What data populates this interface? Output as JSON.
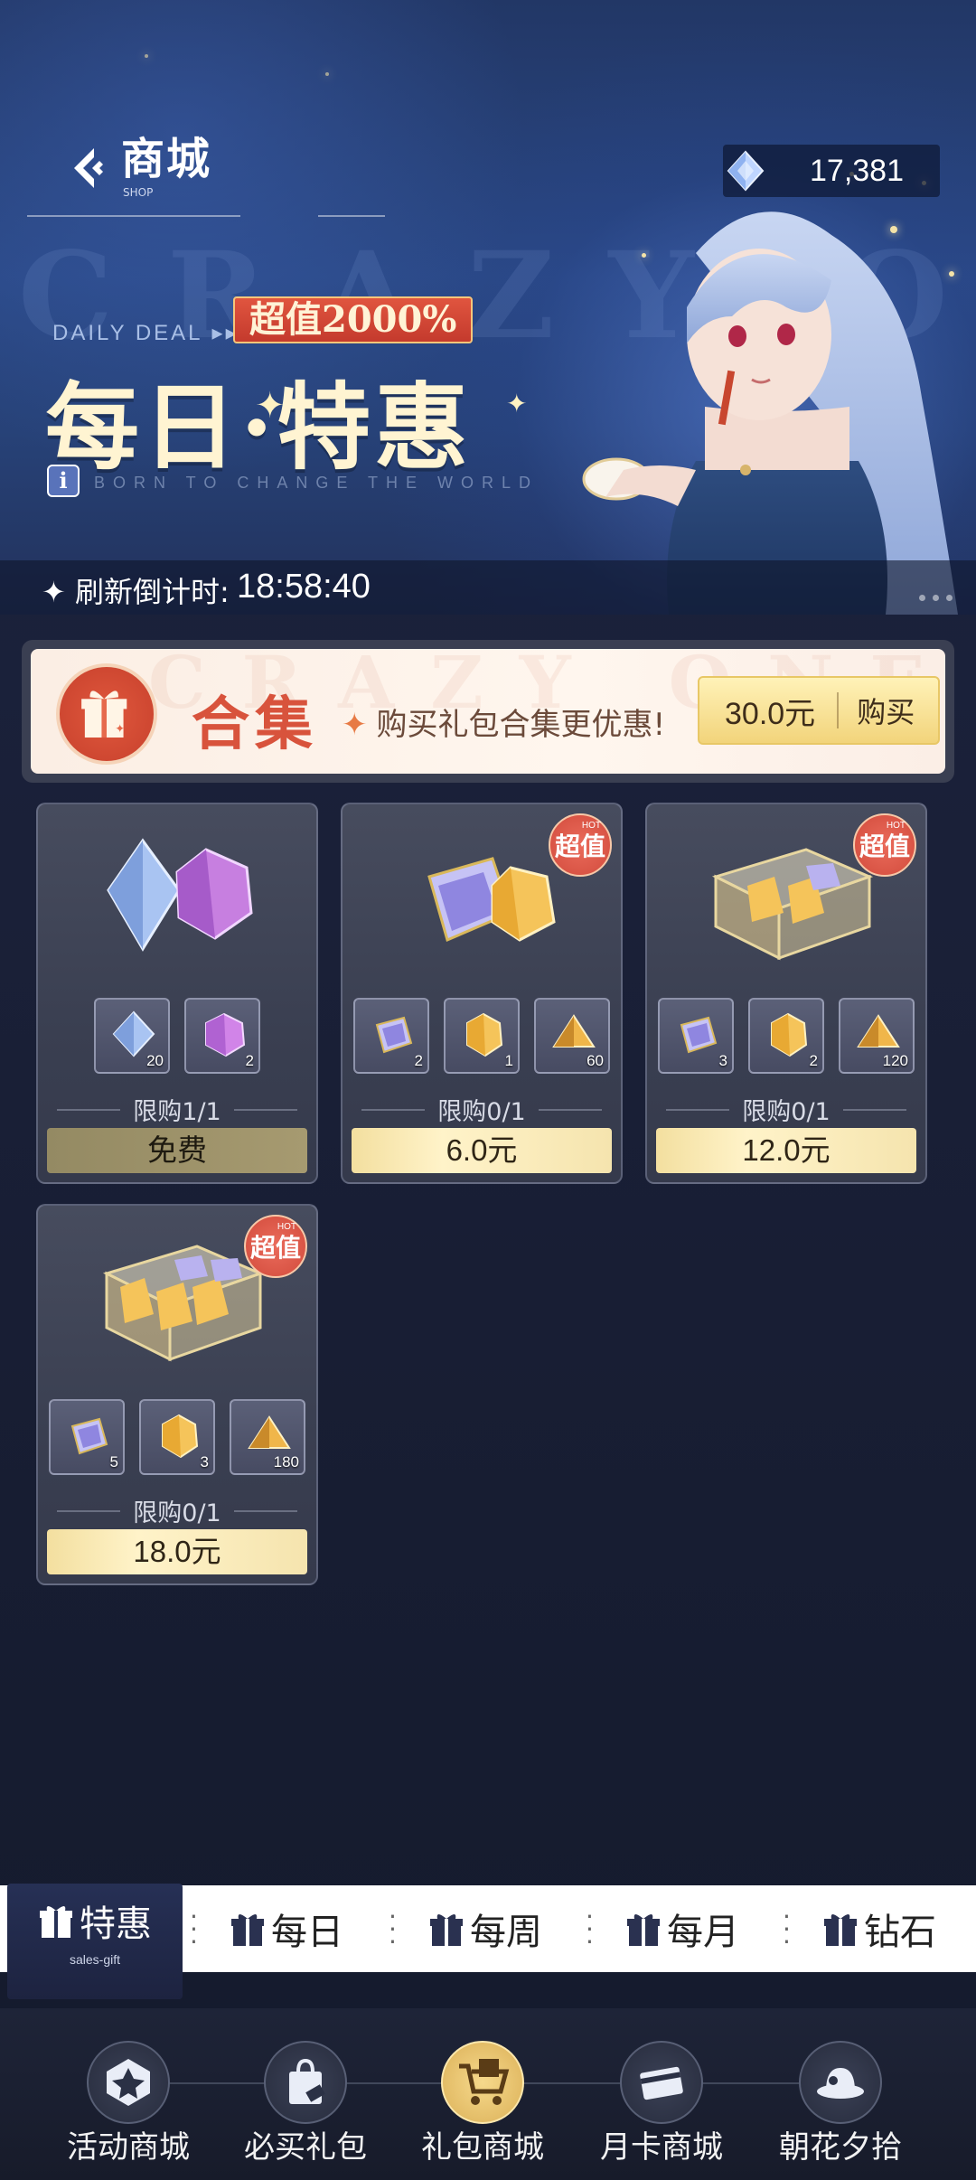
{
  "header": {
    "title": "商城",
    "subtitle": "SHOP",
    "currency_value": "17,381"
  },
  "banner": {
    "bg_text": "CRAZY ONES",
    "daily_label": "DAILY DEAL",
    "value_badge": "超值2000%",
    "deal_title": "每日·特惠",
    "info_letter": "i",
    "tagline": "BORN TO CHANGE THE WORLD",
    "countdown_label": "刷新倒计时:",
    "countdown_time": "18:58:40"
  },
  "bundle": {
    "bg_text": "CRAZY ONES",
    "title": "合集",
    "description": "购买礼包合集更优惠!",
    "price": "30.0元",
    "buy_label": "购买"
  },
  "cards": [
    {
      "hot": false,
      "rewards": [
        {
          "icon": "blue-diamond-icon",
          "qty": "20"
        },
        {
          "icon": "pink-crystal-icon",
          "qty": "2"
        }
      ],
      "limit": "限购1/1",
      "price": "免费"
    },
    {
      "hot": true,
      "rewards": [
        {
          "icon": "caged-crystal-icon",
          "qty": "2"
        },
        {
          "icon": "gold-crystal-icon",
          "qty": "1"
        },
        {
          "icon": "gold-shard-icon",
          "qty": "60"
        }
      ],
      "limit": "限购0/1",
      "price": "6.0元"
    },
    {
      "hot": true,
      "rewards": [
        {
          "icon": "caged-crystal-icon",
          "qty": "3"
        },
        {
          "icon": "gold-crystal-icon",
          "qty": "2"
        },
        {
          "icon": "gold-shard-icon",
          "qty": "120"
        }
      ],
      "limit": "限购0/1",
      "price": "12.0元"
    },
    {
      "hot": true,
      "rewards": [
        {
          "icon": "caged-crystal-icon",
          "qty": "5"
        },
        {
          "icon": "gold-crystal-icon",
          "qty": "3"
        },
        {
          "icon": "gold-shard-icon",
          "qty": "180"
        }
      ],
      "limit": "限购0/1",
      "price": "18.0元"
    }
  ],
  "hot_badge": {
    "small": "HOT",
    "text": "超值"
  },
  "category_tabs": [
    {
      "label": "特惠",
      "sub": "sales-gift",
      "active": true
    },
    {
      "label": "每日"
    },
    {
      "label": "每周"
    },
    {
      "label": "每月"
    },
    {
      "label": "钻石"
    }
  ],
  "bottom_nav": [
    {
      "label": "活动商城",
      "icon": "event-shop-icon"
    },
    {
      "label": "必买礼包",
      "icon": "shopping-bag-icon"
    },
    {
      "label": "礼包商城",
      "icon": "shopping-cart-icon",
      "active": true
    },
    {
      "label": "月卡商城",
      "icon": "monthly-card-icon"
    },
    {
      "label": "朝花夕拾",
      "icon": "hat-icon"
    }
  ],
  "colors": {
    "accent_gold": "#f3df9f",
    "hot_red": "#d24b3c",
    "bundle_red": "#d8533c"
  }
}
